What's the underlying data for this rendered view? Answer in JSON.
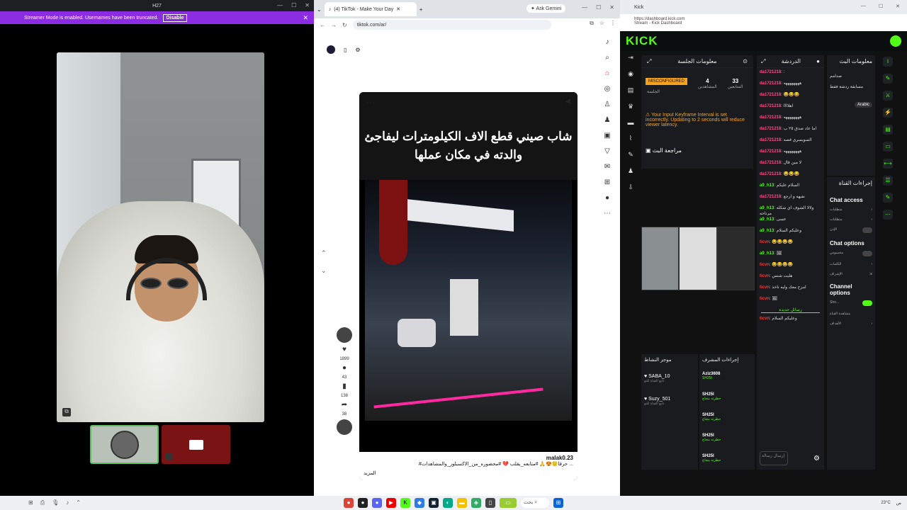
{
  "discord": {
    "title": "H27",
    "banner_text": "Streamer Mode is enabled. Usernames have been truncated.",
    "banner_button": "Disable"
  },
  "browser": {
    "tab_title": "(4) TikTok - Make Your Day",
    "gemini": "Ask Gemini",
    "url": "tiktok.com/ar/",
    "video_title": "شاب صيني قطع الاف الكيلومترات ليفاجئ والدته في مكان عملها",
    "author": "malak0.23",
    "caption": "#حرقا🙂😍🙏 #متابعه_يقلب 💔 #محضوره_من_الاكسبلور_والمشاهدات ...",
    "more": "المزيد",
    "likes": "1899",
    "comments": "43",
    "saves": "138",
    "shares": "38"
  },
  "kick": {
    "tab": "Kick",
    "addr1": "https://dashboard.kick.com",
    "addr2": "Stream - Kick Dashboard",
    "logo": "KICK",
    "session_title": "معلومات الجلسة",
    "misconfigured": "MISCONFIGURED",
    "session_sub": "الجلسة",
    "viewers_value": "4",
    "viewers_label": "المشاهدين",
    "followers_value": "33",
    "followers_label": "المتابعين",
    "warning": "Your Input Keyframe Interval is set incorrectly. Updating to 2 seconds will reduce viewer latency.",
    "review": "مراجعة البث",
    "chat_title": "الدردشة",
    "chat": [
      {
        "u": "da1721218",
        "t": ":",
        "c": "p"
      },
      {
        "u": "da1721218",
        "t": "ههههههههه",
        "c": "p"
      },
      {
        "u": "da1721218",
        "t": "😂😂😂",
        "c": "p"
      },
      {
        "u": "da1721218",
        "t": "اهلاااا",
        "c": "p"
      },
      {
        "u": "da1721218",
        "t": "ههههههههه",
        "c": "p"
      },
      {
        "u": "da1721218",
        "t": "اما عاد صدق ٢٥ ب",
        "c": "p"
      },
      {
        "u": "da1721218",
        "t": "السويسري قصه",
        "c": "p"
      },
      {
        "u": "da1721218",
        "t": "ههههههههه",
        "c": "p"
      },
      {
        "u": "da1721218",
        "t": "لا مين قال",
        "c": "p"
      },
      {
        "u": "da1721218",
        "t": "😂😂😂",
        "c": "p"
      },
      {
        "u": "a9_h13",
        "t": "السلام عليكم",
        "c": "g"
      },
      {
        "u": "da1721218",
        "t": "نفيهه و ارجع",
        "c": "p"
      },
      {
        "u": "a9_h13",
        "t": "ولالا الشوف اي شكله مرتاحه",
        "c": "g"
      },
      {
        "u": "a9_h13",
        "t": "عسى",
        "c": "g"
      },
      {
        "u": "a9_h13",
        "t": "وعليكم السلام",
        "c": "g"
      },
      {
        "u": "ticvn",
        "t": "😂😂😂😂",
        "c": "r"
      },
      {
        "u": "a9_h13",
        "t": "🖼",
        "c": "g"
      },
      {
        "u": "ticvn",
        "t": "😂😂😂😂",
        "c": "r"
      },
      {
        "u": "ticvn",
        "t": "هليت شنس",
        "c": "r"
      },
      {
        "u": "ticvn",
        "t": "امزح معك وليه تاخذ",
        "c": "r"
      },
      {
        "u": "ticvn",
        "t": "🖼",
        "c": "r"
      }
    ],
    "sent": "رسائل جديدة",
    "last_msg": {
      "u": "ticvn",
      "t": "وعليكم السلام"
    },
    "chat_input": "إرسال رسالة",
    "mods_title": "موجز النشاط",
    "mods": [
      {
        "name": "SABA_10",
        "sub": "تابع القناة للتو"
      },
      {
        "name": "Suzy_501",
        "sub": "تابع القناة للتو"
      }
    ],
    "modact_title": "إجراءات المشرف",
    "modact": [
      {
        "name": "Aziz3608",
        "sub": "SH25I"
      },
      {
        "name": "SH25I",
        "sub": "حظرته بنجاح"
      },
      {
        "name": "SH25I",
        "sub": "حظرته بنجاح"
      },
      {
        "name": "SH25I",
        "sub": "حظرته بنجاح"
      },
      {
        "name": "SH25I",
        "sub": "حظرته بنجاح"
      }
    ],
    "info_title": "معلومات البث",
    "info_text": "مسابقة ردشة فقط",
    "info_name": "صدامم",
    "language": "Arabic",
    "actions_title": "إجراءات القناة",
    "chat_access": "Chat access",
    "chat_options": "Chat options",
    "channel_options": "Channel options",
    "opt1": "متطلبات",
    "opt2": "متطلبات",
    "opt3": "الإذن",
    "opt4": "محسوس",
    "opt5": "الكلمات",
    "opt6": "الإشراف",
    "show": "Sho...",
    "opt7": "مشاهدة القناة",
    "opt8": "الأهداف"
  },
  "taskbar": {
    "temp": "23°C",
    "search": "بحث",
    "time": "ص"
  }
}
